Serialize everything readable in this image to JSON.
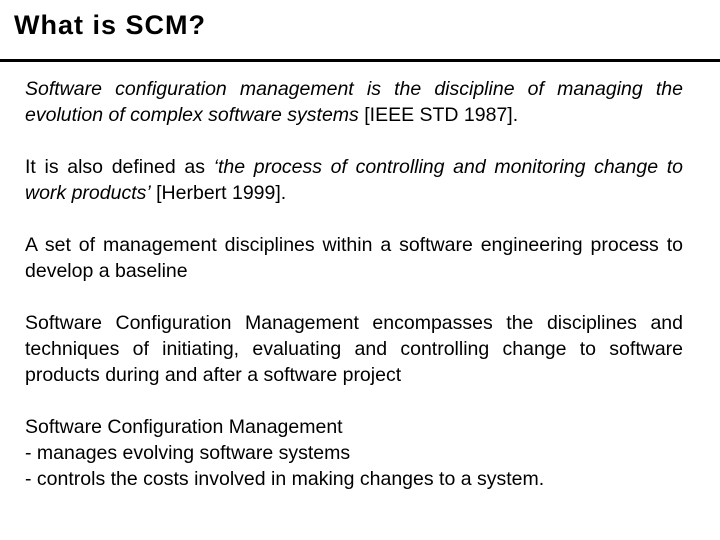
{
  "slide": {
    "title": "What is SCM?",
    "paragraphs": [
      {
        "italic_text": "Software configuration management is the discipline of managing the evolution of complex software systems",
        "normal_text": " [IEEE STD 1987]."
      },
      {
        "pre_text": "It is also defined as ",
        "italic_text": "‘the process of controlling and monitoring change to work products’",
        "post_text": " [Herbert 1999]."
      },
      {
        "text": "A set of management disciplines within a software engineering process to develop a baseline"
      },
      {
        "text": "Software Configuration Management encompasses the disciplines and techniques of initiating, evaluating and controlling change to software products during and after a software project"
      },
      {
        "lines": [
          "Software Configuration Management",
          "- manages evolving software systems",
          "- controls the costs involved in making changes to a system."
        ]
      }
    ]
  }
}
